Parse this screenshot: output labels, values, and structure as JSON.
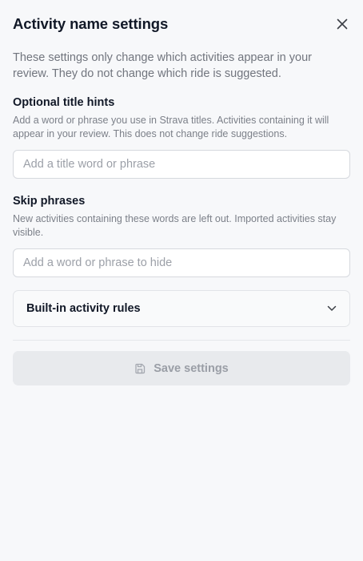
{
  "dialog": {
    "title": "Activity name settings",
    "close_icon": "close-icon",
    "intro": "These settings only change which activities appear in your review. They do not change which ride is suggested."
  },
  "title_hints": {
    "label": "Optional title hints",
    "help": "Add a word or phrase you use in Strava titles. Activities containing it will appear in your review. This does not change ride suggestions.",
    "value": "",
    "placeholder": "Add a title word or phrase"
  },
  "skip_phrases": {
    "label": "Skip phrases",
    "help": "New activities containing these words are left out. Imported activities stay visible.",
    "value": "",
    "placeholder": "Add a word or phrase to hide"
  },
  "builtin_rules": {
    "label": "Built-in activity rules",
    "icon": "chevron-down-icon",
    "expanded": false
  },
  "save": {
    "label": "Save settings",
    "icon": "save-icon",
    "disabled": true
  },
  "colors": {
    "background": "#f7f8fa",
    "text": "#111827",
    "muted_text": "#71757e",
    "input_border": "#d6d9de",
    "disabled_button": "#e8eaed",
    "disabled_text": "#9a9ea6"
  }
}
